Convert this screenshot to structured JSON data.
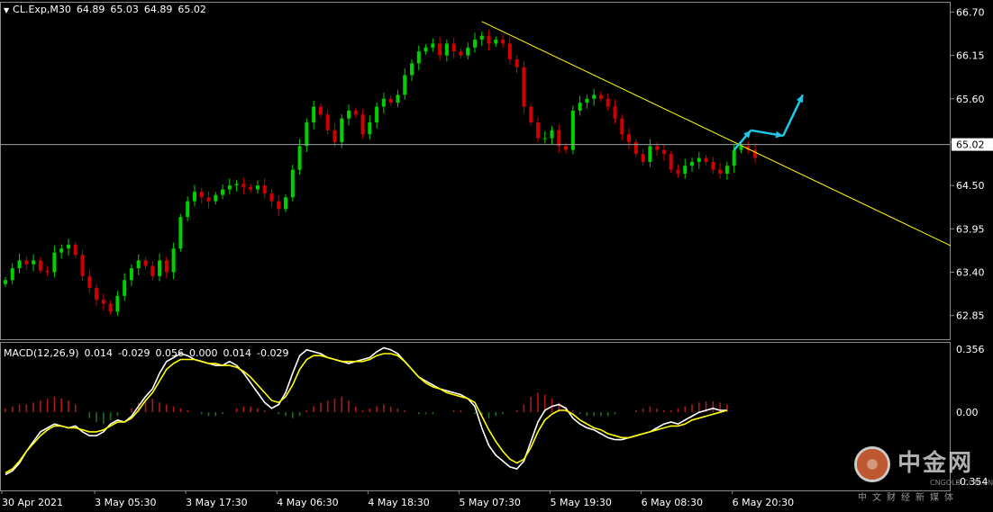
{
  "price_header": {
    "symbol": "CL.Exp,M30",
    "open": "64.89",
    "high": "65.03",
    "low": "64.89",
    "close": "65.02"
  },
  "macd_header": {
    "label": "MACD(12,26,9)",
    "values": [
      "0.014",
      "-0.029",
      "0.056",
      "0.000",
      "0.014",
      "-0.029"
    ]
  },
  "watermark": {
    "name": "中金网",
    "url": "CNGOLD.COM.CN",
    "tagline": "中文财经新媒体"
  },
  "colors": {
    "background": "#000000",
    "bull": "#00d000",
    "bear": "#d00000",
    "trendline": "#ffff00",
    "arrow": "#1ec8e8",
    "macd_line": "#ffffff",
    "signal_line": "#ffff00",
    "hist_pos": "#b01818",
    "hist_neg": "#1f6e1f"
  },
  "chart_data": [
    {
      "type": "candlestick",
      "ylim": [
        62.55,
        66.83
      ],
      "y_ticks": [
        "66.70",
        "66.15",
        "65.60",
        "65.05",
        "64.50",
        "63.95",
        "63.40",
        "62.85"
      ],
      "current_price": "65.02",
      "x_ticks": [
        "30 Apr 2021",
        "3 May 05:30",
        "3 May 17:30",
        "4 May 06:30",
        "4 May 18:30",
        "5 May 07:30",
        "5 May 19:30",
        "6 May 08:30",
        "6 May 20:30"
      ],
      "closes": [
        63.3,
        63.45,
        63.55,
        63.5,
        63.55,
        63.42,
        63.4,
        63.65,
        63.7,
        63.75,
        63.62,
        63.35,
        63.2,
        63.05,
        63.0,
        62.9,
        63.1,
        63.3,
        63.45,
        63.55,
        63.48,
        63.35,
        63.55,
        63.4,
        63.7,
        64.1,
        64.3,
        64.42,
        64.35,
        64.3,
        64.38,
        64.45,
        64.5,
        64.52,
        64.48,
        64.45,
        64.5,
        64.4,
        64.3,
        64.2,
        64.35,
        64.7,
        65.0,
        65.3,
        65.5,
        65.4,
        65.2,
        65.05,
        65.35,
        65.45,
        65.4,
        65.15,
        65.3,
        65.5,
        65.6,
        65.55,
        65.65,
        65.9,
        66.05,
        66.2,
        66.25,
        66.3,
        66.15,
        66.3,
        66.2,
        66.15,
        66.25,
        66.35,
        66.4,
        66.3,
        66.35,
        66.3,
        66.1,
        66.0,
        65.5,
        65.3,
        65.1,
        65.1,
        65.2,
        65.0,
        64.95,
        65.45,
        65.55,
        65.6,
        65.65,
        65.6,
        65.5,
        65.35,
        65.15,
        65.05,
        64.9,
        64.8,
        65.0,
        64.95,
        64.9,
        64.7,
        64.65,
        64.75,
        64.8,
        64.85,
        64.8,
        64.7,
        64.65,
        64.75,
        64.95,
        65.0,
        64.95,
        64.85
      ]
    },
    {
      "type": "line",
      "ylim": [
        -0.4,
        0.36
      ],
      "y_ticks": [
        "0.356",
        "0.00",
        "-0.354"
      ],
      "series": [
        {
          "values": [
            -0.32,
            -0.3,
            -0.26,
            -0.2,
            -0.15,
            -0.1,
            -0.08,
            -0.06,
            -0.07,
            -0.08,
            -0.07,
            -0.1,
            -0.12,
            -0.12,
            -0.1,
            -0.06,
            -0.04,
            -0.05,
            -0.02,
            0.03,
            0.08,
            0.12,
            0.2,
            0.26,
            0.28,
            0.3,
            0.29,
            0.27,
            0.26,
            0.25,
            0.24,
            0.24,
            0.26,
            0.24,
            0.2,
            0.15,
            0.1,
            0.05,
            0.02,
            0.04,
            0.1,
            0.2,
            0.29,
            0.32,
            0.31,
            0.3,
            0.28,
            0.27,
            0.26,
            0.25,
            0.26,
            0.27,
            0.28,
            0.31,
            0.33,
            0.32,
            0.3,
            0.26,
            0.22,
            0.18,
            0.16,
            0.14,
            0.12,
            0.11,
            0.1,
            0.09,
            0.07,
            0.03,
            -0.08,
            -0.17,
            -0.22,
            -0.25,
            -0.28,
            -0.29,
            -0.25,
            -0.15,
            -0.05,
            0.01,
            0.03,
            0.04,
            0.02,
            -0.03,
            -0.06,
            -0.08,
            -0.09,
            -0.11,
            -0.13,
            -0.14,
            -0.14,
            -0.13,
            -0.12,
            -0.11,
            -0.1,
            -0.08,
            -0.06,
            -0.05,
            -0.06,
            -0.04,
            -0.02,
            0.0,
            0.01,
            0.02,
            0.01,
            0.01
          ]
        },
        {
          "values": [
            -0.31,
            -0.29,
            -0.25,
            -0.2,
            -0.16,
            -0.12,
            -0.09,
            -0.07,
            -0.07,
            -0.08,
            -0.08,
            -0.09,
            -0.1,
            -0.1,
            -0.09,
            -0.07,
            -0.05,
            -0.05,
            -0.03,
            0.01,
            0.06,
            0.1,
            0.16,
            0.22,
            0.25,
            0.27,
            0.27,
            0.27,
            0.26,
            0.25,
            0.25,
            0.24,
            0.24,
            0.23,
            0.21,
            0.18,
            0.14,
            0.1,
            0.06,
            0.05,
            0.08,
            0.14,
            0.22,
            0.27,
            0.29,
            0.29,
            0.28,
            0.27,
            0.26,
            0.26,
            0.26,
            0.26,
            0.27,
            0.29,
            0.3,
            0.3,
            0.29,
            0.26,
            0.22,
            0.18,
            0.15,
            0.13,
            0.12,
            0.1,
            0.09,
            0.08,
            0.07,
            0.05,
            -0.02,
            -0.09,
            -0.15,
            -0.2,
            -0.24,
            -0.26,
            -0.24,
            -0.18,
            -0.1,
            -0.04,
            -0.01,
            0.01,
            0.01,
            -0.01,
            -0.04,
            -0.06,
            -0.08,
            -0.09,
            -0.11,
            -0.12,
            -0.13,
            -0.13,
            -0.12,
            -0.11,
            -0.1,
            -0.09,
            -0.08,
            -0.07,
            -0.07,
            -0.06,
            -0.04,
            -0.03,
            -0.02,
            -0.01,
            0.0,
            0.01
          ]
        },
        {
          "values": [
            0.02,
            0.03,
            0.04,
            0.04,
            0.05,
            0.06,
            0.07,
            0.08,
            0.07,
            0.06,
            0.04,
            0.0,
            -0.03,
            -0.05,
            -0.06,
            -0.04,
            -0.02,
            0.0,
            0.02,
            0.05,
            0.06,
            0.07,
            0.05,
            0.04,
            0.03,
            0.02,
            0.01,
            0.0,
            -0.01,
            -0.02,
            -0.02,
            -0.01,
            0.0,
            0.02,
            0.03,
            0.03,
            0.02,
            0.01,
            0.0,
            -0.01,
            -0.02,
            -0.03,
            -0.02,
            0.01,
            0.03,
            0.05,
            0.06,
            0.07,
            0.08,
            0.06,
            0.03,
            0.01,
            0.02,
            0.03,
            0.04,
            0.03,
            0.02,
            0.01,
            0.0,
            -0.01,
            -0.01,
            -0.01,
            0.0,
            0.0,
            0.01,
            0.01,
            0.0,
            -0.01,
            -0.02,
            -0.03,
            -0.02,
            -0.01,
            0.0,
            0.01,
            0.04,
            0.08,
            0.1,
            0.09,
            0.07,
            0.05,
            0.03,
            0.01,
            -0.01,
            -0.02,
            -0.02,
            -0.02,
            -0.02,
            -0.01,
            0.0,
            0.0,
            0.01,
            0.02,
            0.03,
            0.02,
            0.01,
            0.01,
            0.02,
            0.03,
            0.04,
            0.05,
            0.055,
            0.056,
            0.05,
            0.04
          ]
        }
      ]
    }
  ]
}
